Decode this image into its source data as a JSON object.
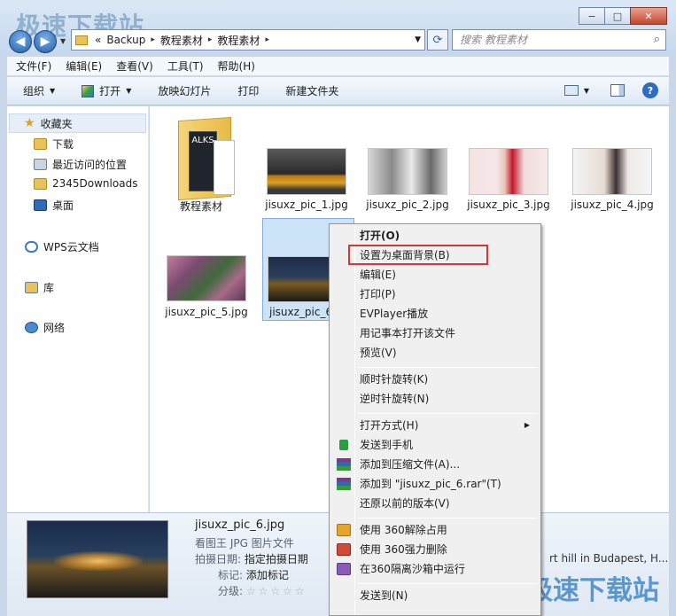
{
  "watermark": {
    "top": "极速下载站",
    "bottom": "极速下载站"
  },
  "window_buttons": {
    "minimize": "−",
    "maximize": "□",
    "close": "✕"
  },
  "nav": {
    "back": "◀",
    "forward": "▶",
    "dropdown": "▼"
  },
  "address": {
    "overflow": "«",
    "crumbs": [
      "Backup",
      "教程素材",
      "教程素材"
    ],
    "separator": "▸",
    "dropdown": "▼"
  },
  "refresh": "⟳",
  "search": {
    "placeholder": "搜索 教程素材",
    "icon": "⌕"
  },
  "menubar": [
    "文件(F)",
    "编辑(E)",
    "查看(V)",
    "工具(T)",
    "帮助(H)"
  ],
  "toolbar": {
    "organize": "组织",
    "open": "打开",
    "slideshow": "放映幻灯片",
    "print": "打印",
    "new_folder": "新建文件夹",
    "caret": "▼",
    "help": "?"
  },
  "sidebar": {
    "favorites": "收藏夹",
    "items": [
      "下载",
      "最近访问的位置",
      "2345Downloads",
      "桌面"
    ],
    "wps": "WPS云文档",
    "library": "库",
    "network": "网络"
  },
  "files": [
    {
      "name": "教程素材"
    },
    {
      "name": "jisuxz_pic_1.jpg"
    },
    {
      "name": "jisuxz_pic_2.jpg"
    },
    {
      "name": "jisuxz_pic_3.jpg"
    },
    {
      "name": "jisuxz_pic_4.jpg"
    },
    {
      "name": "jisuxz_pic_5.jpg"
    },
    {
      "name": "jisuxz_pic_6"
    }
  ],
  "folder_cover_text": "ALKS",
  "context_menu": {
    "items": [
      {
        "label": "打开(O)",
        "bold": true
      },
      {
        "label": "设置为桌面背景(B)"
      },
      {
        "label": "编辑(E)"
      },
      {
        "label": "打印(P)"
      },
      {
        "label": "EVPlayer播放"
      },
      {
        "label": "用记事本打开该文件"
      },
      {
        "label": "预览(V)"
      },
      {
        "label": "顺时针旋转(K)"
      },
      {
        "label": "逆时针旋转(N)"
      },
      {
        "label": "打开方式(H)",
        "submenu": "▶"
      },
      {
        "label": "发送到手机"
      },
      {
        "label": "添加到压缩文件(A)..."
      },
      {
        "label": "添加到 \"jisuxz_pic_6.rar\"(T)"
      },
      {
        "label": "还原以前的版本(V)"
      },
      {
        "label": "使用 360解除占用"
      },
      {
        "label": "使用 360强力删除"
      },
      {
        "label": "在360隔离沙箱中运行"
      },
      {
        "label": "发送到(N)"
      }
    ]
  },
  "details": {
    "filename": "jisuxz_pic_6.jpg",
    "type": "看图王 JPG 图片文件",
    "date_label": "拍摄日期:",
    "date_value": "指定拍摄日期",
    "tags_label": "标记:",
    "tags_value": "添加标记",
    "rating_label": "分级:",
    "rating_stars": "☆☆☆☆☆",
    "caption": "rt hill in Budapest, H..."
  },
  "colors": {
    "highlight_border": "#d0383a",
    "selection": "#cde3f8"
  }
}
